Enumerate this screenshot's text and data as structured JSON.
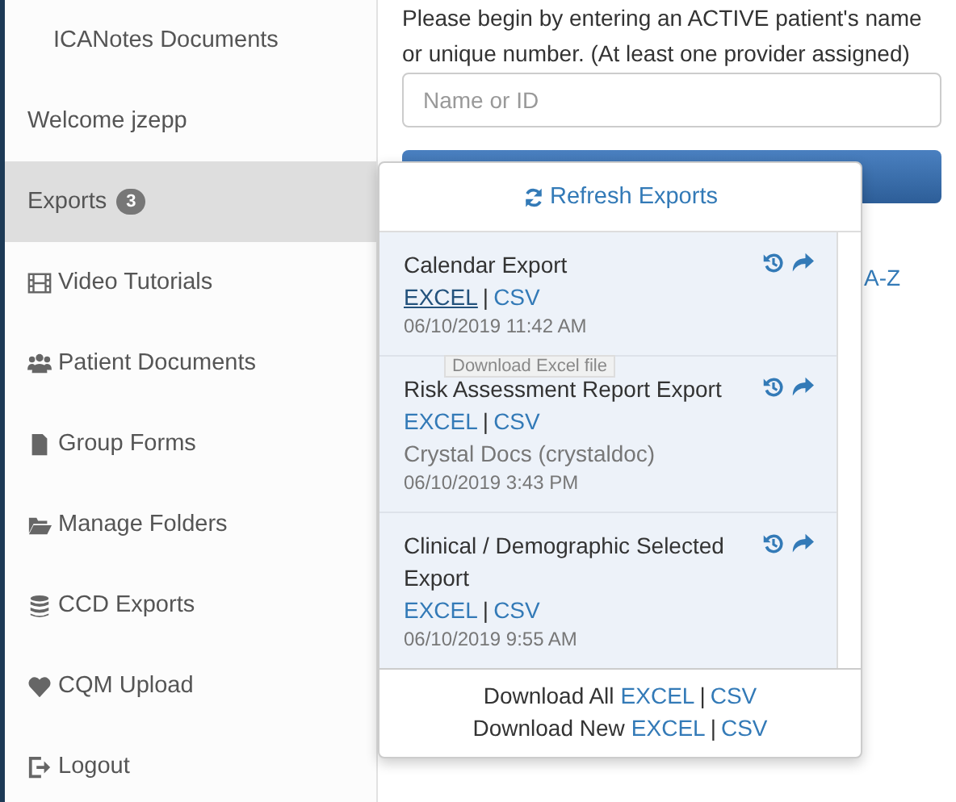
{
  "sidebar": {
    "items": [
      {
        "kind": "title",
        "label": "ICANotes Documents",
        "selected": false
      },
      {
        "kind": "text",
        "label": "Welcome jzepp",
        "selected": false
      },
      {
        "kind": "exports",
        "label": "Exports",
        "badge": "3",
        "selected": true
      },
      {
        "kind": "film",
        "label": "Video Tutorials",
        "selected": false
      },
      {
        "kind": "users",
        "label": "Patient Documents",
        "selected": false
      },
      {
        "kind": "file",
        "label": "Group Forms",
        "selected": false
      },
      {
        "kind": "folder",
        "label": "Manage Folders",
        "selected": false
      },
      {
        "kind": "database",
        "label": "CCD Exports",
        "selected": false
      },
      {
        "kind": "heartbeat",
        "label": "CQM Upload",
        "selected": false
      },
      {
        "kind": "logout",
        "label": "Logout",
        "selected": false
      }
    ]
  },
  "main": {
    "prompt": "Please begin by entering an ACTIVE patient's name or unique number. (At least one provider assigned)",
    "search": {
      "placeholder": "Name or ID"
    },
    "sort_link": "A-Z"
  },
  "exports_popup": {
    "refresh": "Refresh Exports",
    "separator": "|",
    "exports": [
      {
        "title": "Calendar Export",
        "links": [
          {
            "label": "EXCEL",
            "hovered": true
          },
          {
            "label": "CSV",
            "hovered": false
          }
        ],
        "date": "06/10/2019 11:42 AM",
        "tooltip": "Download Excel file"
      },
      {
        "title": "Risk Assessment Report Export",
        "links": [
          {
            "label": "EXCEL",
            "hovered": false
          },
          {
            "label": "CSV",
            "hovered": false
          }
        ],
        "user": "Crystal Docs (crystaldoc)",
        "date": "06/10/2019 3:43 PM"
      },
      {
        "title": "Clinical / Demographic Selected Export",
        "links": [
          {
            "label": "EXCEL",
            "hovered": false
          },
          {
            "label": "CSV",
            "hovered": false
          }
        ],
        "date": "06/10/2019 9:55 AM"
      }
    ],
    "footer": [
      {
        "label": "Download All",
        "links": [
          "EXCEL",
          "CSV"
        ]
      },
      {
        "label": "Download New",
        "links": [
          "EXCEL",
          "CSV"
        ]
      }
    ]
  }
}
